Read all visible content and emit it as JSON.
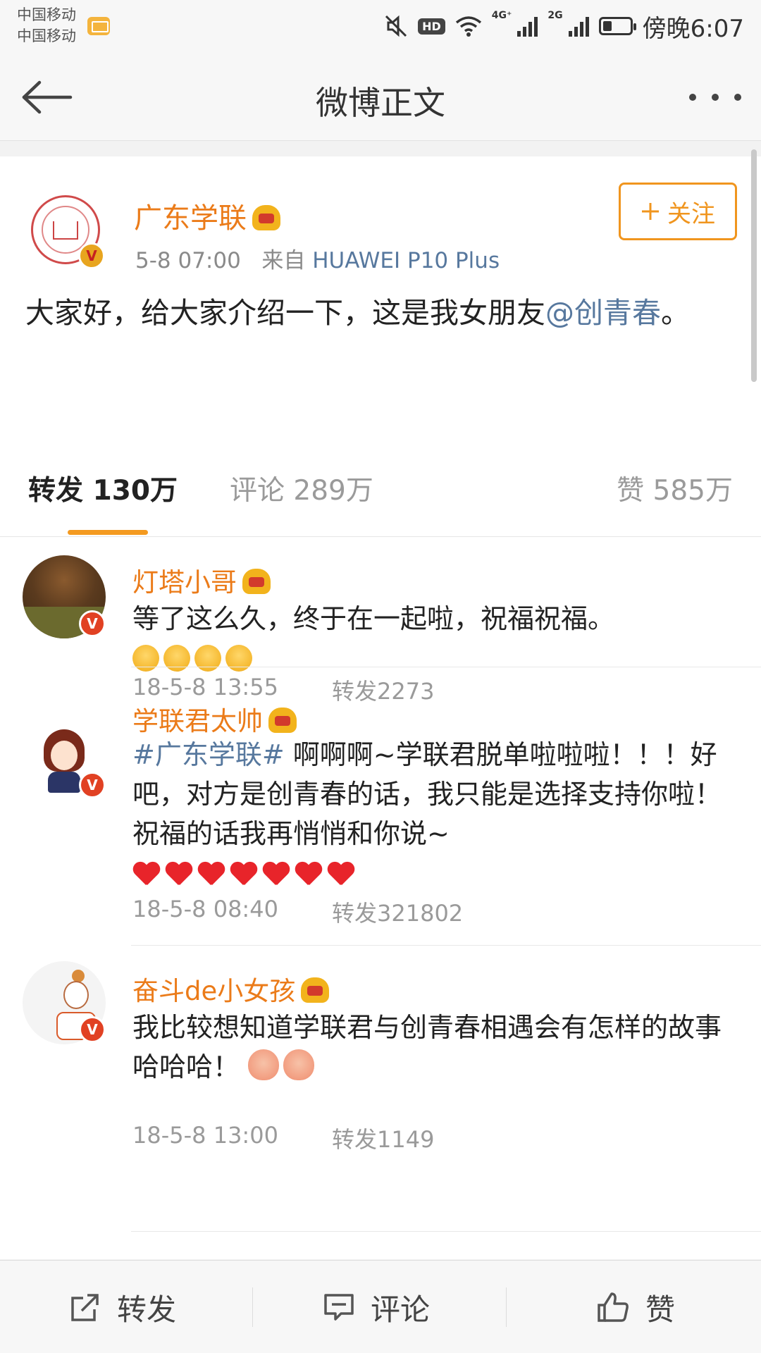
{
  "status_bar": {
    "carrier_1": "中国移动",
    "carrier_2": "中国移动",
    "network_1": "4G⁺",
    "network_2": "2G",
    "hd": "HD",
    "time": "傍晚6:07"
  },
  "nav": {
    "title": "微博正文"
  },
  "post": {
    "author": "广东学联",
    "time": "5-8 07:00",
    "source_prefix": "来自",
    "source": "HUAWEI P10 Plus",
    "follow_label": "关注",
    "text_before": "大家好，给大家介绍一下，这是我女朋友",
    "mention": "@创青春",
    "text_after": "。"
  },
  "tabs": {
    "repost": "转发 130万",
    "comment": "评论 289万",
    "like": "赞 585万"
  },
  "reposts": [
    {
      "name": "灯塔小哥",
      "text": "等了这么久，终于在一起啦，祝福祝福。",
      "time": "18-5-8 13:55",
      "repost_count": "转发2273"
    },
    {
      "name": "学联君太帅",
      "hashtag": "#广东学联#",
      "text": " 啊啊啊~学联君脱单啦啦啦！！！好吧，对方是创青春的话，我只能是选择支持你啦！祝福的话我再悄悄和你说~",
      "time": "18-5-8 08:40",
      "repost_count": "转发321802"
    },
    {
      "name": "奋斗de小女孩",
      "text": "我比较想知道学联君与创青春相遇会有怎样的故事哈哈哈！",
      "time": "18-5-8 13:00",
      "repost_count": "转发1149"
    }
  ],
  "toolbar": {
    "repost": "转发",
    "comment": "评论",
    "like": "赞"
  },
  "colors": {
    "orange_name": "#eb7b19",
    "link_blue": "#57789e",
    "accent": "#f49a20"
  }
}
